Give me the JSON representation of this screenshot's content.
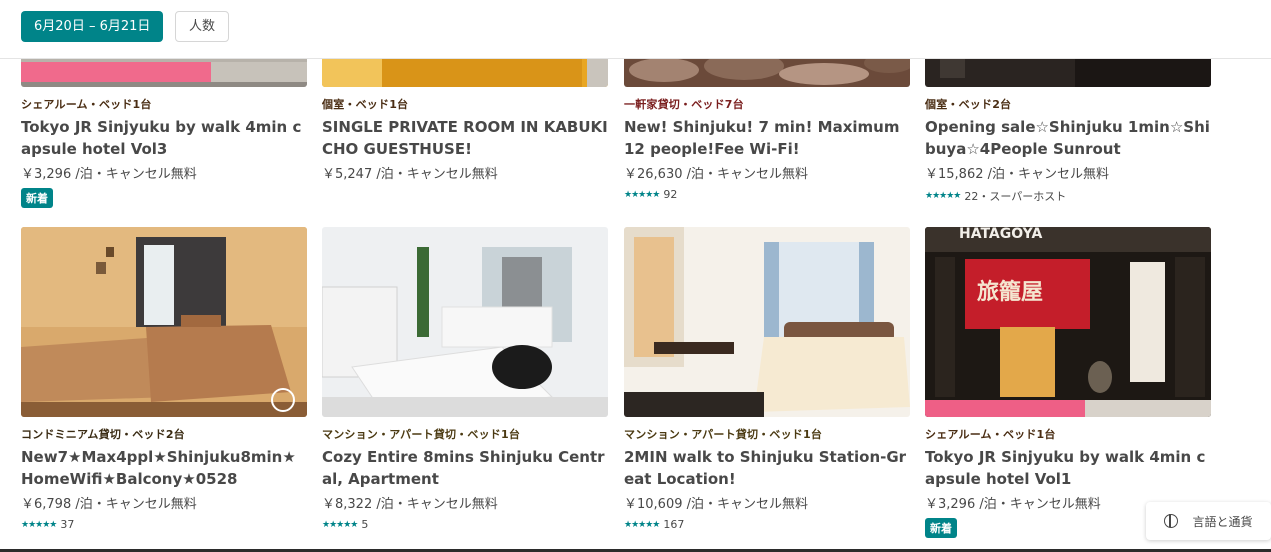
{
  "filters": {
    "date_label": "6月20日 – 6月21日",
    "guests_label": "人数"
  },
  "colors": {
    "accent": "#008489",
    "type_shared": "#4a2d13",
    "type_private": "#4a2d13",
    "type_house": "#7a1e1e",
    "type_condo": "#3a2b13",
    "type_mansion": "#4b3a12"
  },
  "listings": [
    {
      "type": "シェアルーム・ベッド1台",
      "title": "Tokyo JR Sinjyuku by walk 4min capsule hotel Vol3",
      "price": "￥3,296 /泊・キャンセル無料",
      "badge": "新着",
      "stars": "",
      "reviews": ""
    },
    {
      "type": "個室・ベッド1台",
      "title": "SINGLE PRIVATE ROOM IN KABUKICHO GUESTHUSE!",
      "price": "￥5,247 /泊・キャンセル無料",
      "badge": "",
      "stars": "",
      "reviews": ""
    },
    {
      "type": "一軒家貸切・ベッド7台",
      "title": "New! Shinjuku! 7 min! Maximum 12 people!Fee Wi-Fi!",
      "price": "￥26,630 /泊・キャンセル無料",
      "badge": "",
      "stars": "★★★★★",
      "reviews": "92"
    },
    {
      "type": "個室・ベッド2台",
      "title": "Opening sale☆Shinjuku 1min☆Shibuya☆4People Sunrout",
      "price": "￥15,862 /泊・キャンセル無料",
      "badge": "",
      "stars": "★★★★★",
      "reviews": "22・スーパーホスト"
    },
    {
      "type": "コンドミニアム貸切・ベッド2台",
      "title": "New7★Max4ppl★Shinjuku8min★HomeWifi★Balcony★0528",
      "price": "￥6,798 /泊・キャンセル無料",
      "badge": "",
      "stars": "★★★★★",
      "reviews": "37"
    },
    {
      "type": "マンション・アパート貸切・ベッド1台",
      "title": "Cozy Entire 8mins Shinjuku Central, Apartment",
      "price": "￥8,322 /泊・キャンセル無料",
      "badge": "",
      "stars": "★★★★★",
      "reviews": "5"
    },
    {
      "type": "マンション・アパート貸切・ベッド1台",
      "title": "2MIN walk to Shinjuku Station-Great Location!",
      "price": "￥10,609 /泊・キャンセル無料",
      "badge": "",
      "stars": "★★★★★",
      "reviews": "167"
    },
    {
      "type": "シェアルーム・ベッド1台",
      "title": "Tokyo JR Sinjyuku by walk 4min capsule hotel Vol1",
      "price": "￥3,296 /泊・キャンセル無料",
      "badge": "新着",
      "stars": "",
      "reviews": ""
    }
  ],
  "photo_text": {
    "hatagoya": "HATAGOYA",
    "noren": "旅籠屋"
  },
  "footer": {
    "language_currency": "言語と通貨"
  }
}
